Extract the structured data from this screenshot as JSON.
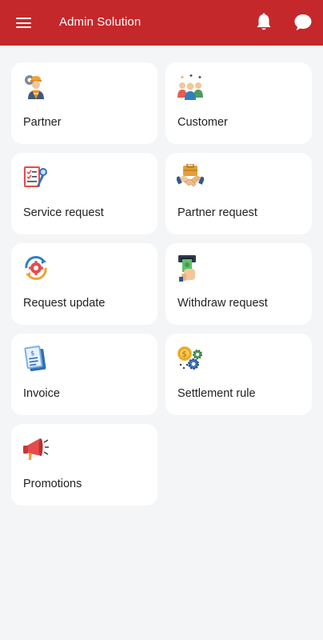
{
  "header": {
    "title": "Admin Solution",
    "menu_icon": "hamburger-menu-icon",
    "bell_icon": "bell-icon",
    "chat_icon": "chat-bubble-icon",
    "background_color": "#c4282b"
  },
  "tiles": [
    {
      "label": "Partner",
      "icon": "worker-icon"
    },
    {
      "label": "Customer",
      "icon": "customers-group-icon"
    },
    {
      "label": "Service request",
      "icon": "checklist-icon"
    },
    {
      "label": "Partner request",
      "icon": "handshake-icon"
    },
    {
      "label": "Request update",
      "icon": "update-cycle-icon"
    },
    {
      "label": "Withdraw request",
      "icon": "atm-withdraw-icon"
    },
    {
      "label": "Invoice",
      "icon": "invoice-icon"
    },
    {
      "label": "Settlement rule",
      "icon": "coin-gears-icon"
    },
    {
      "label": "Promotions",
      "icon": "megaphone-icon"
    }
  ]
}
